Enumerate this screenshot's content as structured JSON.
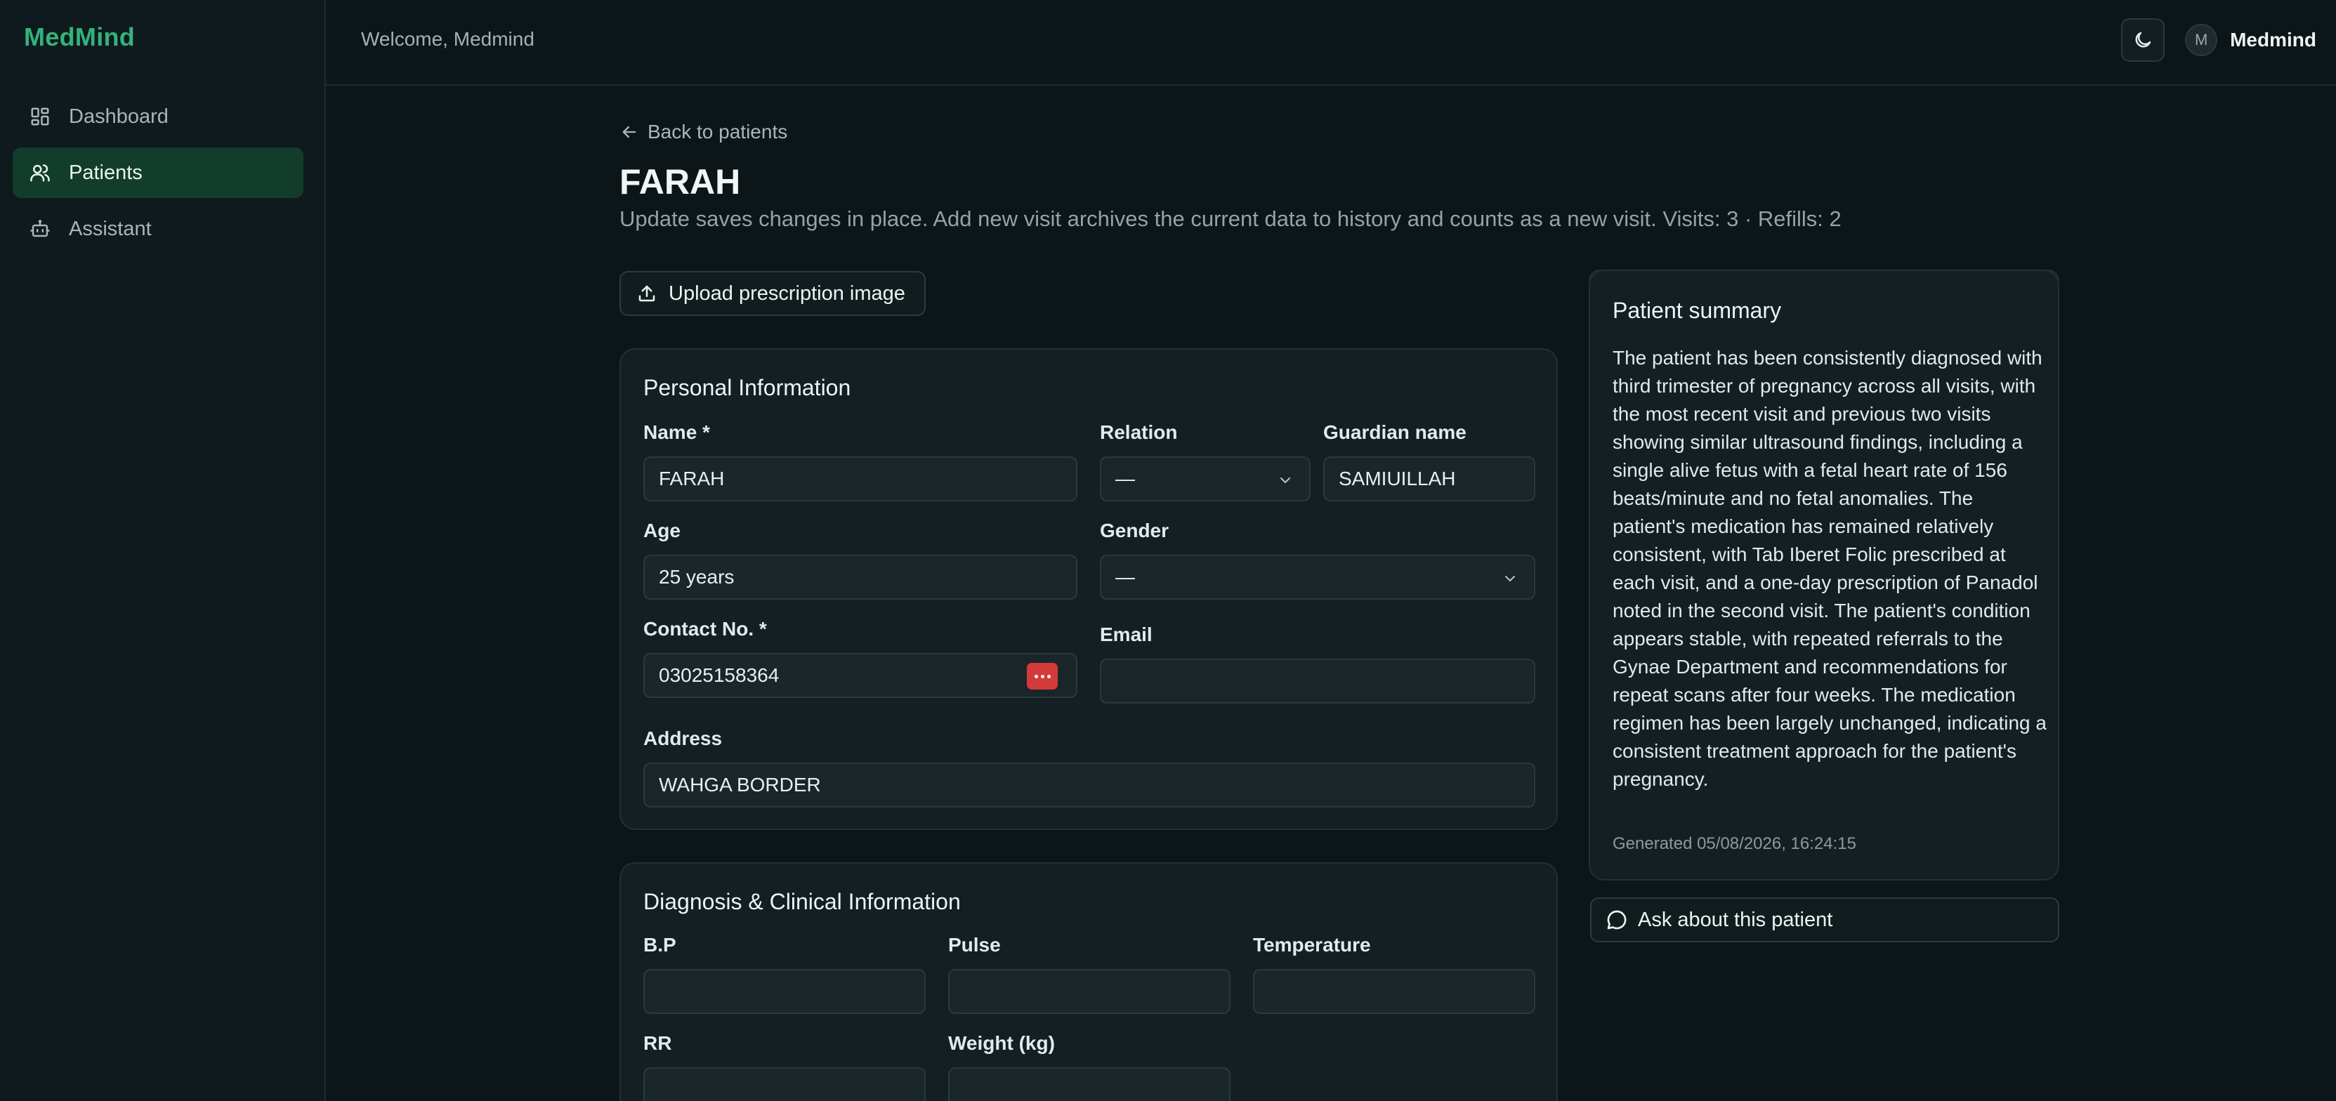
{
  "brand": "MedMind",
  "sidebar": {
    "items": [
      {
        "label": "Dashboard",
        "icon": "dashboard-icon"
      },
      {
        "label": "Patients",
        "icon": "users-icon"
      },
      {
        "label": "Assistant",
        "icon": "bot-icon"
      }
    ]
  },
  "topbar": {
    "welcome": "Welcome, Medmind",
    "avatar_initial": "M",
    "username": "Medmind"
  },
  "main": {
    "back_label": "Back to patients",
    "title": "FARAH",
    "subtitle": "Update saves changes in place. Add new visit archives the current data to history and counts as a new visit. Visits: 3 · Refills: 2",
    "upload_label": "Upload prescription image"
  },
  "personal": {
    "title": "Personal Information",
    "name_label": "Name *",
    "name_value": "FARAH",
    "relation_label": "Relation",
    "relation_value": "—",
    "guardian_label": "Guardian name",
    "guardian_value": "SAMIUILLAH",
    "age_label": "Age",
    "age_value": "25 years",
    "gender_label": "Gender",
    "gender_value": "—",
    "contact_label": "Contact No. *",
    "contact_value": "03025158364",
    "email_label": "Email",
    "email_value": "",
    "address_label": "Address",
    "address_value": "WAHGA BORDER"
  },
  "diagnosis": {
    "title": "Diagnosis & Clinical Information",
    "bp_label": "B.P",
    "pulse_label": "Pulse",
    "temperature_label": "Temperature",
    "rr_label": "RR",
    "weight_label": "Weight (kg)"
  },
  "summary": {
    "title": "Patient summary",
    "text": "The patient has been consistently diagnosed with third trimester of pregnancy across all visits, with the most recent visit and previous two visits showing similar ultrasound findings, including a single alive fetus with a fetal heart rate of 156 beats/minute and no fetal anomalies. The patient's medication has remained relatively consistent, with Tab Iberet Folic prescribed at each visit, and a one-day prescription of Panadol noted in the second visit. The patient's condition appears stable, with repeated referrals to the Gynae Department and recommendations for repeat scans after four weeks. The medication regimen has been largely unchanged, indicating a consistent treatment approach for the patient's pregnancy.",
    "generated": "Generated 05/08/2026, 16:24:15",
    "ask_label": "Ask about this patient"
  },
  "colors": {
    "brand": "#34b27b",
    "active_nav_bg": "#123d2b",
    "contact_action": "#d33a3a",
    "background": "#0c1518"
  }
}
